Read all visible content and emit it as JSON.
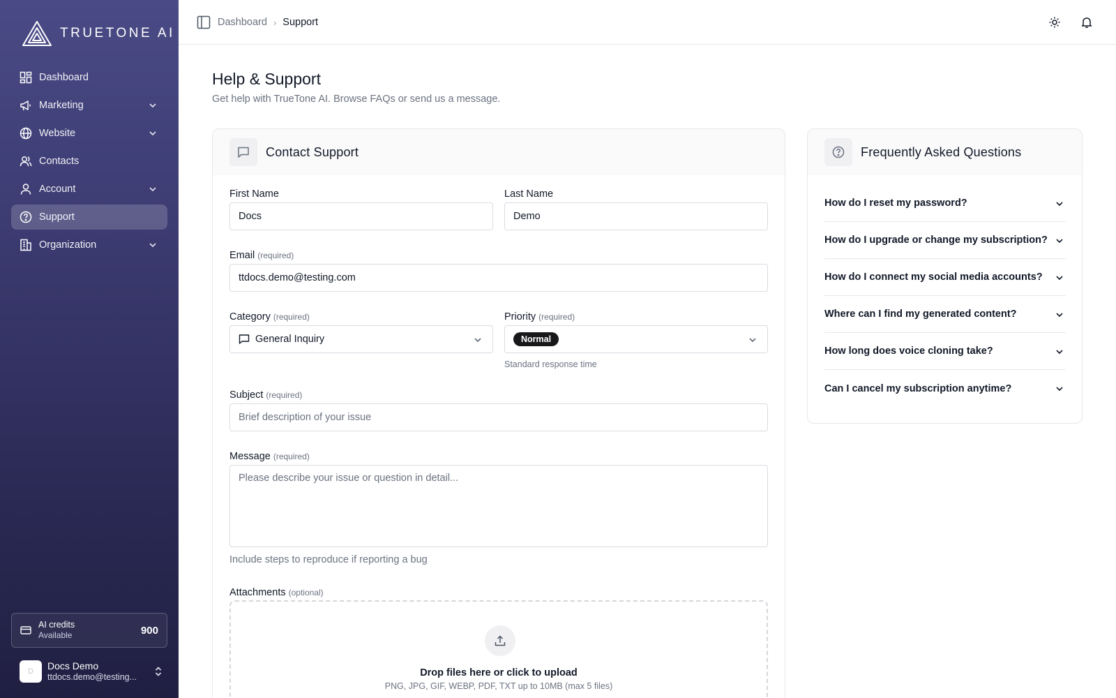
{
  "brand": {
    "name": "TRUETONE AI"
  },
  "sidebar": {
    "items": [
      {
        "label": "Dashboard",
        "icon": "dashboard-icon",
        "expandable": false
      },
      {
        "label": "Marketing",
        "icon": "megaphone-icon",
        "expandable": true
      },
      {
        "label": "Website",
        "icon": "globe-icon",
        "expandable": true
      },
      {
        "label": "Contacts",
        "icon": "users-icon",
        "expandable": false
      },
      {
        "label": "Account",
        "icon": "user-icon",
        "expandable": true
      },
      {
        "label": "Support",
        "icon": "help-circle-icon",
        "expandable": false,
        "active": true
      },
      {
        "label": "Organization",
        "icon": "building-icon",
        "expandable": true
      }
    ],
    "credits": {
      "label": "AI credits",
      "sublabel": "Available",
      "value": "900"
    },
    "user": {
      "name": "Docs Demo",
      "email": "ttdocs.demo@testing...",
      "avatar_text": "D"
    }
  },
  "topbar": {
    "breadcrumb": [
      "Dashboard",
      "Support"
    ],
    "breadcrumb_sep": "›"
  },
  "page": {
    "title": "Help & Support",
    "subtitle": "Get help with TrueTone AI. Browse FAQs or send us a message."
  },
  "contact": {
    "title": "Contact Support",
    "first_name": {
      "label": "First Name",
      "value": "Docs"
    },
    "last_name": {
      "label": "Last Name",
      "value": "Demo"
    },
    "email": {
      "label": "Email",
      "req": "(required)",
      "value": "ttdocs.demo@testing.com"
    },
    "category": {
      "label": "Category",
      "req": "(required)",
      "value": "General Inquiry"
    },
    "priority": {
      "label": "Priority",
      "req": "(required)",
      "value": "Normal",
      "hint": "Standard response time"
    },
    "subject": {
      "label": "Subject",
      "req": "(required)",
      "placeholder": "Brief description of your issue"
    },
    "message": {
      "label": "Message",
      "req": "(required)",
      "placeholder": "Please describe your issue or question in detail...",
      "hint": "Include steps to reproduce if reporting a bug"
    },
    "attachments": {
      "label": "Attachments",
      "req": "(optional)",
      "title": "Drop files here or click to upload",
      "subtitle": "PNG, JPG, GIF, WEBP, PDF, TXT up to 10MB (max 5 files)"
    }
  },
  "faq": {
    "title": "Frequently Asked Questions",
    "items": [
      "How do I reset my password?",
      "How do I upgrade or change my subscription?",
      "How do I connect my social media accounts?",
      "Where can I find my generated content?",
      "How long does voice cloning take?",
      "Can I cancel my subscription anytime?"
    ]
  }
}
